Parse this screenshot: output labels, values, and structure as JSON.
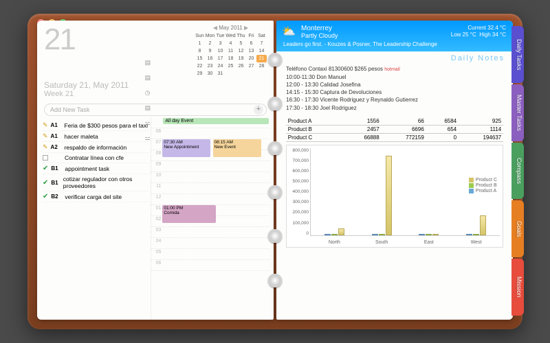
{
  "header": {
    "day_number": "21",
    "date_line": "Saturday 21, May 2011",
    "week_line": "Week 21"
  },
  "calendar": {
    "caption": "May 2011",
    "days": [
      "Sun",
      "Mon",
      "Tue",
      "Wed",
      "Thu",
      "Fri",
      "Sat"
    ],
    "rows": [
      [
        "1",
        "2",
        "3",
        "4",
        "5",
        "6",
        "7"
      ],
      [
        "8",
        "9",
        "10",
        "11",
        "12",
        "13",
        "14"
      ],
      [
        "15",
        "16",
        "17",
        "18",
        "19",
        "20",
        "21"
      ],
      [
        "22",
        "23",
        "24",
        "25",
        "26",
        "27",
        "28"
      ],
      [
        "29",
        "30",
        "31",
        "",
        "",
        "",
        ""
      ]
    ],
    "today": "21"
  },
  "add_task_placeholder": "Add New Task",
  "tasks": [
    {
      "label": "A1",
      "icon": "pen",
      "text": "Feria de $300 pesos para el taxi"
    },
    {
      "label": "A1",
      "icon": "pen",
      "text": "hacer maleta"
    },
    {
      "label": "A2",
      "icon": "pen",
      "text": "respaldo de información"
    },
    {
      "label": "",
      "icon": "box",
      "text": "Contratar línea con cfe"
    },
    {
      "label": "B1",
      "icon": "chk",
      "text": "appointment task"
    },
    {
      "label": "B1",
      "icon": "chk",
      "text": "cotizar regulador con otros proveedores"
    },
    {
      "label": "B2",
      "icon": "chk",
      "text": "verificar carga del site"
    }
  ],
  "side_icons": [
    "note-icon",
    "note-icon",
    "clock-icon",
    "note-icon",
    "org-icon",
    "org-icon"
  ],
  "schedule": {
    "allday": "All day Event",
    "hours": [
      "06",
      "07",
      "08",
      "09",
      "10",
      "11",
      "12",
      "01",
      "02",
      "03",
      "04",
      "05",
      "06"
    ],
    "appts": [
      {
        "row": 2,
        "cls": "ap1",
        "time": "07:30 AM",
        "title": "New Appointment"
      },
      {
        "row": 2,
        "cls": "ap2",
        "time": "08:15 AM",
        "title": "New Event"
      },
      {
        "row": 8,
        "cls": "ap3",
        "time": "01:00 PM",
        "title": "Comida"
      }
    ]
  },
  "weather": {
    "city": "Monterrey",
    "cond": "Partly Cloudy",
    "current": "Current  32.4 °C",
    "low": "Low 25 °C",
    "high": "High 34 °C",
    "quote": "Leaders go first. - Kouzes & Posner, The Leadership Challenge"
  },
  "daily_notes_title": "Daily Notes",
  "notes": {
    "contact": "Teléfono Contaxi 81300600 $265 pesos",
    "hotmail": "hotmail",
    "lines": [
      "10:00-11:30 Don Manuel",
      "12:00 - 13:30 Calidad Josefina",
      "14:15 - 15:30 Captura de Devoluciones",
      "16:30 - 17:30 Vicente Rodriguez y Reynaldo Gutierrez",
      "17:30 - 18:30 Joel Rodriguez"
    ]
  },
  "product_table": {
    "rows": [
      [
        "Product A",
        "1556",
        "66",
        "6584",
        "925"
      ],
      [
        "Product B",
        "2457",
        "6696",
        "654",
        "1114"
      ],
      [
        "Product C",
        "66888",
        "772159",
        "0",
        "194637"
      ]
    ]
  },
  "chart_data": {
    "type": "bar",
    "title": "",
    "xlabel": "",
    "ylabel": "",
    "ylim": [
      0,
      800000
    ],
    "yticks": [
      0,
      100000,
      200000,
      300000,
      400000,
      500000,
      600000,
      700000,
      800000
    ],
    "categories": [
      "North",
      "South",
      "East",
      "West"
    ],
    "series": [
      {
        "name": "Product A",
        "values": [
          1556,
          66,
          6584,
          925
        ],
        "color": "#6aa8d8"
      },
      {
        "name": "Product B",
        "values": [
          2457,
          6696,
          654,
          1114
        ],
        "color": "#9bcb4e"
      },
      {
        "name": "Product C",
        "values": [
          66888,
          772159,
          0,
          194637
        ],
        "color": "#d4c468"
      }
    ],
    "legend": [
      "Product C",
      "Product B",
      "Product A"
    ]
  },
  "tabs": [
    {
      "label": "Daily Tasks",
      "color": "#5a4fcf"
    },
    {
      "label": "Master Tasks",
      "color": "#8b5fbf"
    },
    {
      "label": "Compass",
      "color": "#4a9f5f"
    },
    {
      "label": "Goals",
      "color": "#e67e22"
    },
    {
      "label": "Mission",
      "color": "#e74c3c"
    }
  ]
}
